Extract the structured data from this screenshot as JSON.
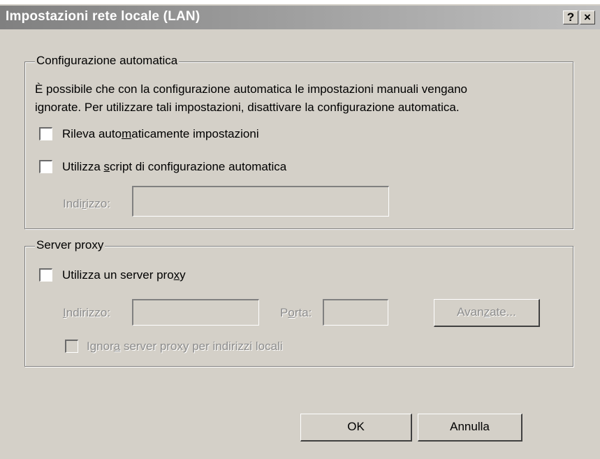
{
  "window": {
    "title": "Impostazioni rete locale (LAN)",
    "help_glyph": "?",
    "close_glyph": "×"
  },
  "auto_config": {
    "legend": "Configurazione automatica",
    "description_line1": "È possibile che con la configurazione automatica le impostazioni manuali vengano",
    "description_line2": "ignorate. Per utilizzare tali impostazioni, disattivare la configurazione automatica.",
    "detect_label_pre": "Rileva auto",
    "detect_label_u": "m",
    "detect_label_post": "aticamente impostazioni",
    "script_label_pre": "Utilizza ",
    "script_label_u": "s",
    "script_label_post": "cript di configurazione automatica",
    "address_label_pre": "Indi",
    "address_label_u": "r",
    "address_label_post": "izzo:"
  },
  "proxy": {
    "legend": "Server proxy",
    "use_proxy_pre": "Utilizza un server pro",
    "use_proxy_u": "x",
    "use_proxy_post": "y",
    "address_label_u": "I",
    "address_label_post": "ndirizzo:",
    "port_label_pre": "P",
    "port_label_u": "o",
    "port_label_post": "rta:",
    "advanced_pre": "Avan",
    "advanced_u": "z",
    "advanced_post": "ate...",
    "bypass_pre": "Ignor",
    "bypass_u": "a",
    "bypass_post": " server proxy per indirizzi locali"
  },
  "buttons": {
    "ok": "OK",
    "cancel": "Annulla"
  }
}
